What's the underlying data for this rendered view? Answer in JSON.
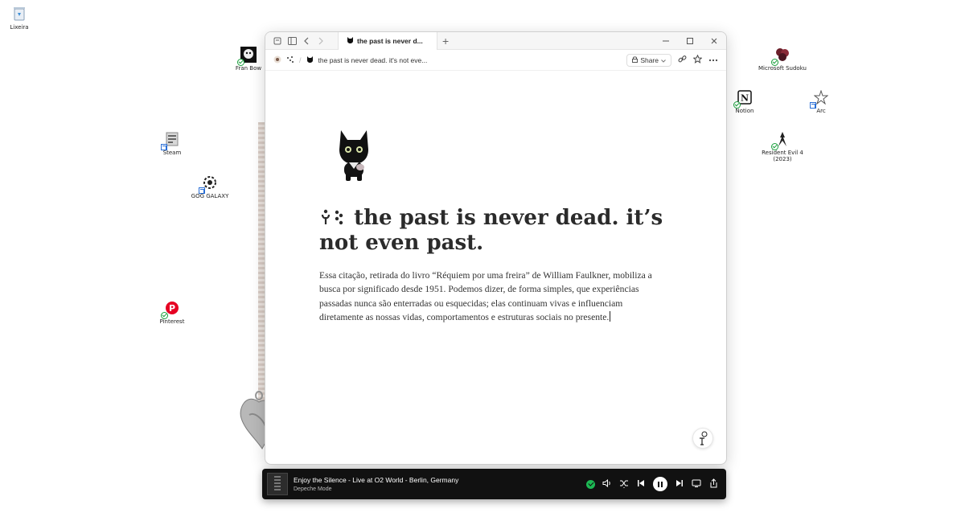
{
  "desktop": {
    "icons": [
      {
        "label": "Lixeira",
        "icon": "recycle-bin-icon"
      },
      {
        "label": "Fran Bow",
        "icon": "fran-bow-icon"
      },
      {
        "label": "Steam",
        "icon": "steam-icon"
      },
      {
        "label": "GOG GALAXY",
        "icon": "gog-galaxy-icon"
      },
      {
        "label": "Pinterest",
        "icon": "pinterest-icon"
      },
      {
        "label": "Microsoft Sudoku",
        "icon": "sudoku-icon"
      },
      {
        "label": "Notion",
        "icon": "notion-icon"
      },
      {
        "label": "Arc",
        "icon": "arc-icon"
      },
      {
        "label": "Resident Evil 4 (2023)",
        "icon": "resident-evil-icon"
      }
    ]
  },
  "browser": {
    "tab_title": "the past is never d...",
    "breadcrumb_title": "the past is never dead. it's not eve...",
    "share_label": "Share",
    "new_tab_symbol": "+",
    "accent": "#222222"
  },
  "page": {
    "title": "the past is never dead. it’s not even past.",
    "body": "Essa citação, retirada do livro “Réquiem por uma freira” de William Faulkner, mobiliza a busca por significado desde 1951. Podemos dizer, de forma simples, que experiências passadas nunca são enterradas ou esquecidas; elas continuam vivas e influenciam diretamente as nossas vidas, comportamentos e estruturas sociais no presente."
  },
  "player": {
    "track_title": "Enjoy the Silence - Live at O2 World - Berlin, Germany",
    "artist": "Depeche Mode",
    "state": "playing",
    "accent": "#1db954"
  }
}
